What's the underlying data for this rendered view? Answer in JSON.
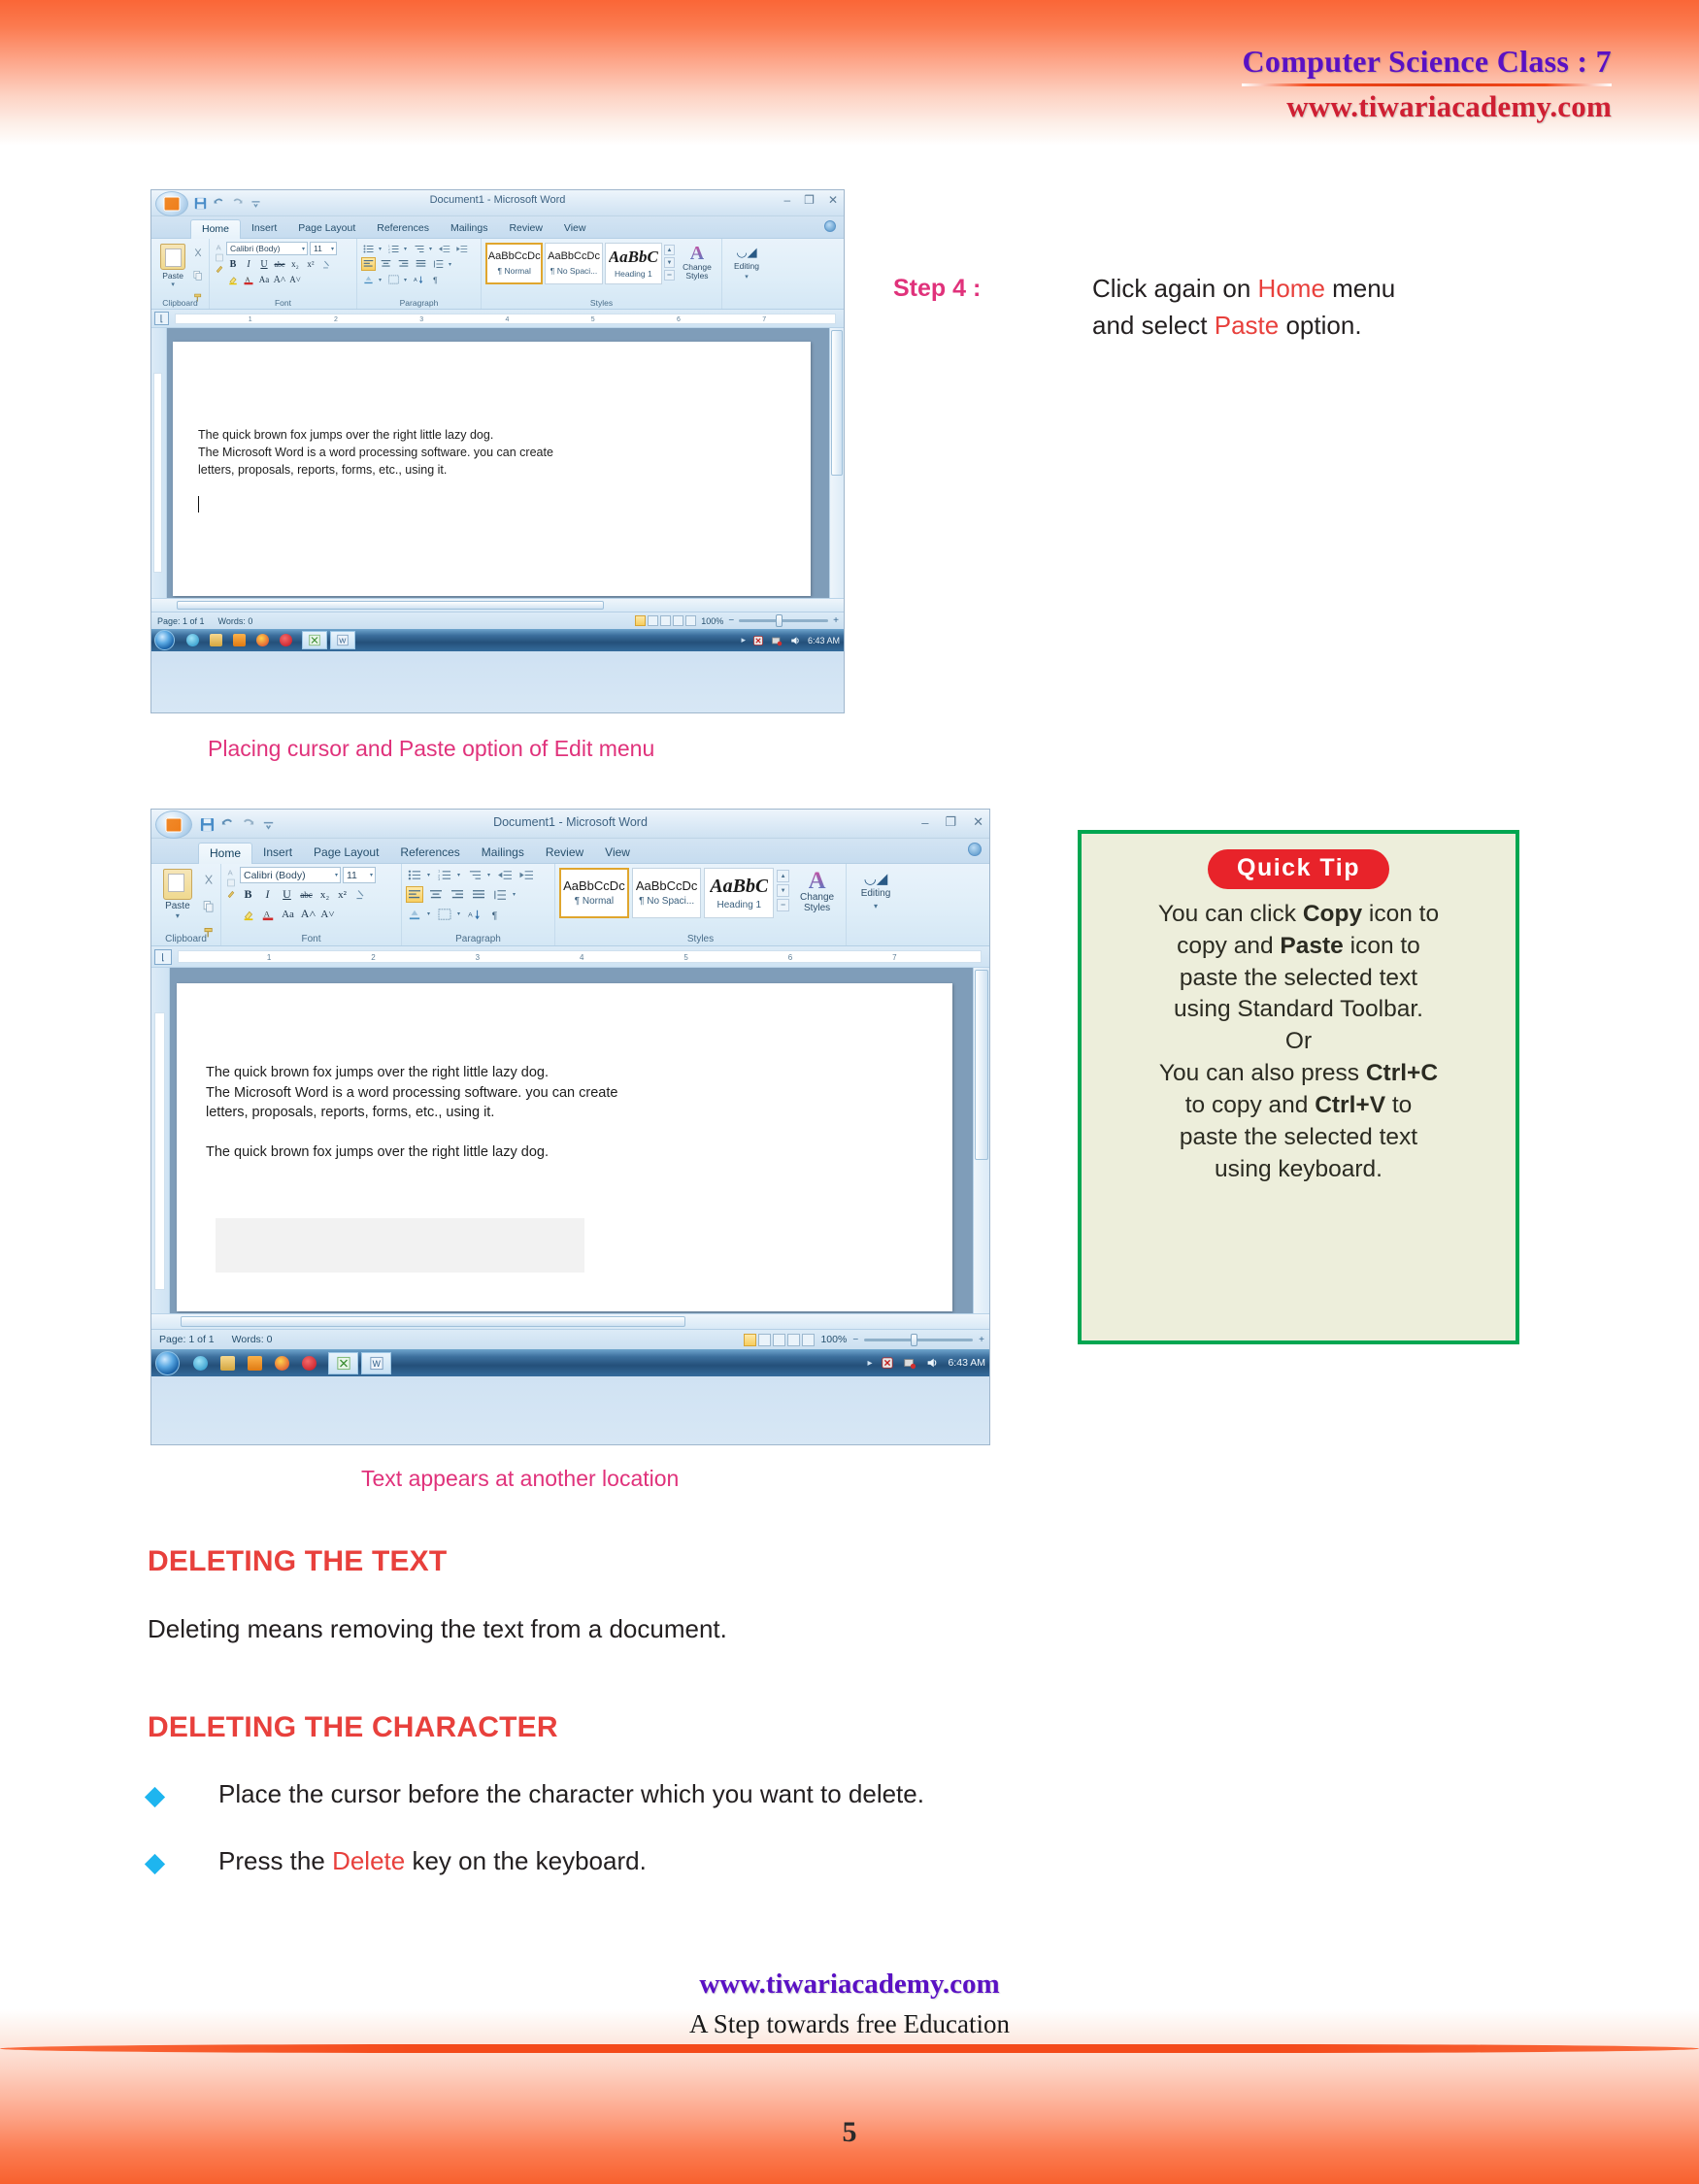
{
  "header": {
    "title": "Computer Science Class : 7",
    "site": "www.tiwariacademy.com"
  },
  "word_window": {
    "doc_title": "Document1 - Microsoft Word",
    "window_buttons": {
      "minimize": "–",
      "restore": "❐",
      "close": "✕"
    },
    "tabs": [
      "Home",
      "Insert",
      "Page Layout",
      "References",
      "Mailings",
      "Review",
      "View"
    ],
    "active_tab": "Home",
    "groups": {
      "clipboard": {
        "label": "Clipboard",
        "paste_label": "Paste"
      },
      "font": {
        "label": "Font",
        "font_name": "Calibri (Body)",
        "font_size": "11",
        "bold": "B",
        "italic": "I",
        "underline": "U",
        "strike": "abc",
        "subscript": "x₂",
        "superscript": "x²",
        "change_case": "Aa",
        "grow_font": "A˄",
        "shrink_font": "A˅"
      },
      "paragraph": {
        "label": "Paragraph"
      },
      "styles": {
        "label": "Styles",
        "cards": [
          {
            "sample": "AaBbCcDc",
            "name": "¶ Normal",
            "selected": true
          },
          {
            "sample": "AaBbCcDc",
            "name": "¶ No Spaci...",
            "selected": false
          },
          {
            "sample": "AaBbC",
            "name": "Heading 1",
            "selected": false
          }
        ],
        "change_styles": "Change Styles"
      },
      "editing": {
        "label": "Editing"
      }
    },
    "ruler_marks": [
      "1",
      "2",
      "3",
      "4",
      "5",
      "6",
      "7"
    ],
    "status": {
      "page": "Page: 1 of 1",
      "words": "Words: 0",
      "zoom": "100%",
      "zoom_out": "−",
      "zoom_in": "+"
    },
    "taskbar": {
      "time": "6:43 AM"
    }
  },
  "screenshot_1": {
    "doc_lines": [
      "The quick brown fox jumps over the right little lazy dog.",
      "The  Microsoft Word is a word processing software. you can create",
      "letters, proposals, reports, forms, etc., using it."
    ],
    "caption": "Placing cursor and Paste option of Edit menu"
  },
  "screenshot_2": {
    "doc_lines": [
      "The quick brown fox jumps over the right little lazy dog.",
      "The  Microsoft Word is a word processing software. you can create",
      "letters, proposals, reports, forms, etc., using it."
    ],
    "pasted_line": "The quick brown fox jumps over the right little lazy dog.",
    "caption": "Text appears at another location"
  },
  "step": {
    "label": "Step 4 :",
    "line1_a": "Click again on ",
    "line1_hl": "Home",
    "line1_b": " menu",
    "line2_a": "and select ",
    "line2_hl": "Paste",
    "line2_b": " option."
  },
  "quick_tip": {
    "badge": "Quick Tip",
    "lines": [
      {
        "plain1": "You can click ",
        "bold1": "Copy",
        "plain2": " icon to"
      },
      {
        "plain1": "copy and ",
        "bold1": "Paste",
        "plain2": " icon to"
      },
      {
        "plain1": "paste the selected text",
        "bold1": "",
        "plain2": ""
      },
      {
        "plain1": "using Standard Toolbar.",
        "bold1": "",
        "plain2": ""
      },
      {
        "plain1": "Or",
        "bold1": "",
        "plain2": ""
      },
      {
        "plain1": "You can also press ",
        "bold1": "Ctrl+C",
        "plain2": ""
      },
      {
        "plain1": "to copy and ",
        "bold1": "Ctrl+V",
        "plain2": " to"
      },
      {
        "plain1": "paste the selected text",
        "bold1": "",
        "plain2": ""
      },
      {
        "plain1": "using keyboard.",
        "bold1": "",
        "plain2": ""
      }
    ]
  },
  "sections": {
    "heading_1": "DELETING THE TEXT",
    "para_1": "Deleting means removing the text from a document.",
    "heading_2": "DELETING THE CHARACTER",
    "bullet_1": "Place the cursor before the character which you want to delete.",
    "bullet_2_a": "Press the ",
    "bullet_2_hl": "Delete",
    "bullet_2_b": " key on the keyboard."
  },
  "footer": {
    "site": "www.tiwariacademy.com",
    "tagline": "A Step towards free Education",
    "page_number": "5"
  },
  "colors": {
    "accent_orange": "#f4491a",
    "heading_red": "#e8403c",
    "caption_pink": "#e0327b",
    "purple": "#5a11c4",
    "tip_green": "#00a651",
    "tip_red": "#e8232a",
    "bullet_cyan": "#1eb5ef"
  }
}
